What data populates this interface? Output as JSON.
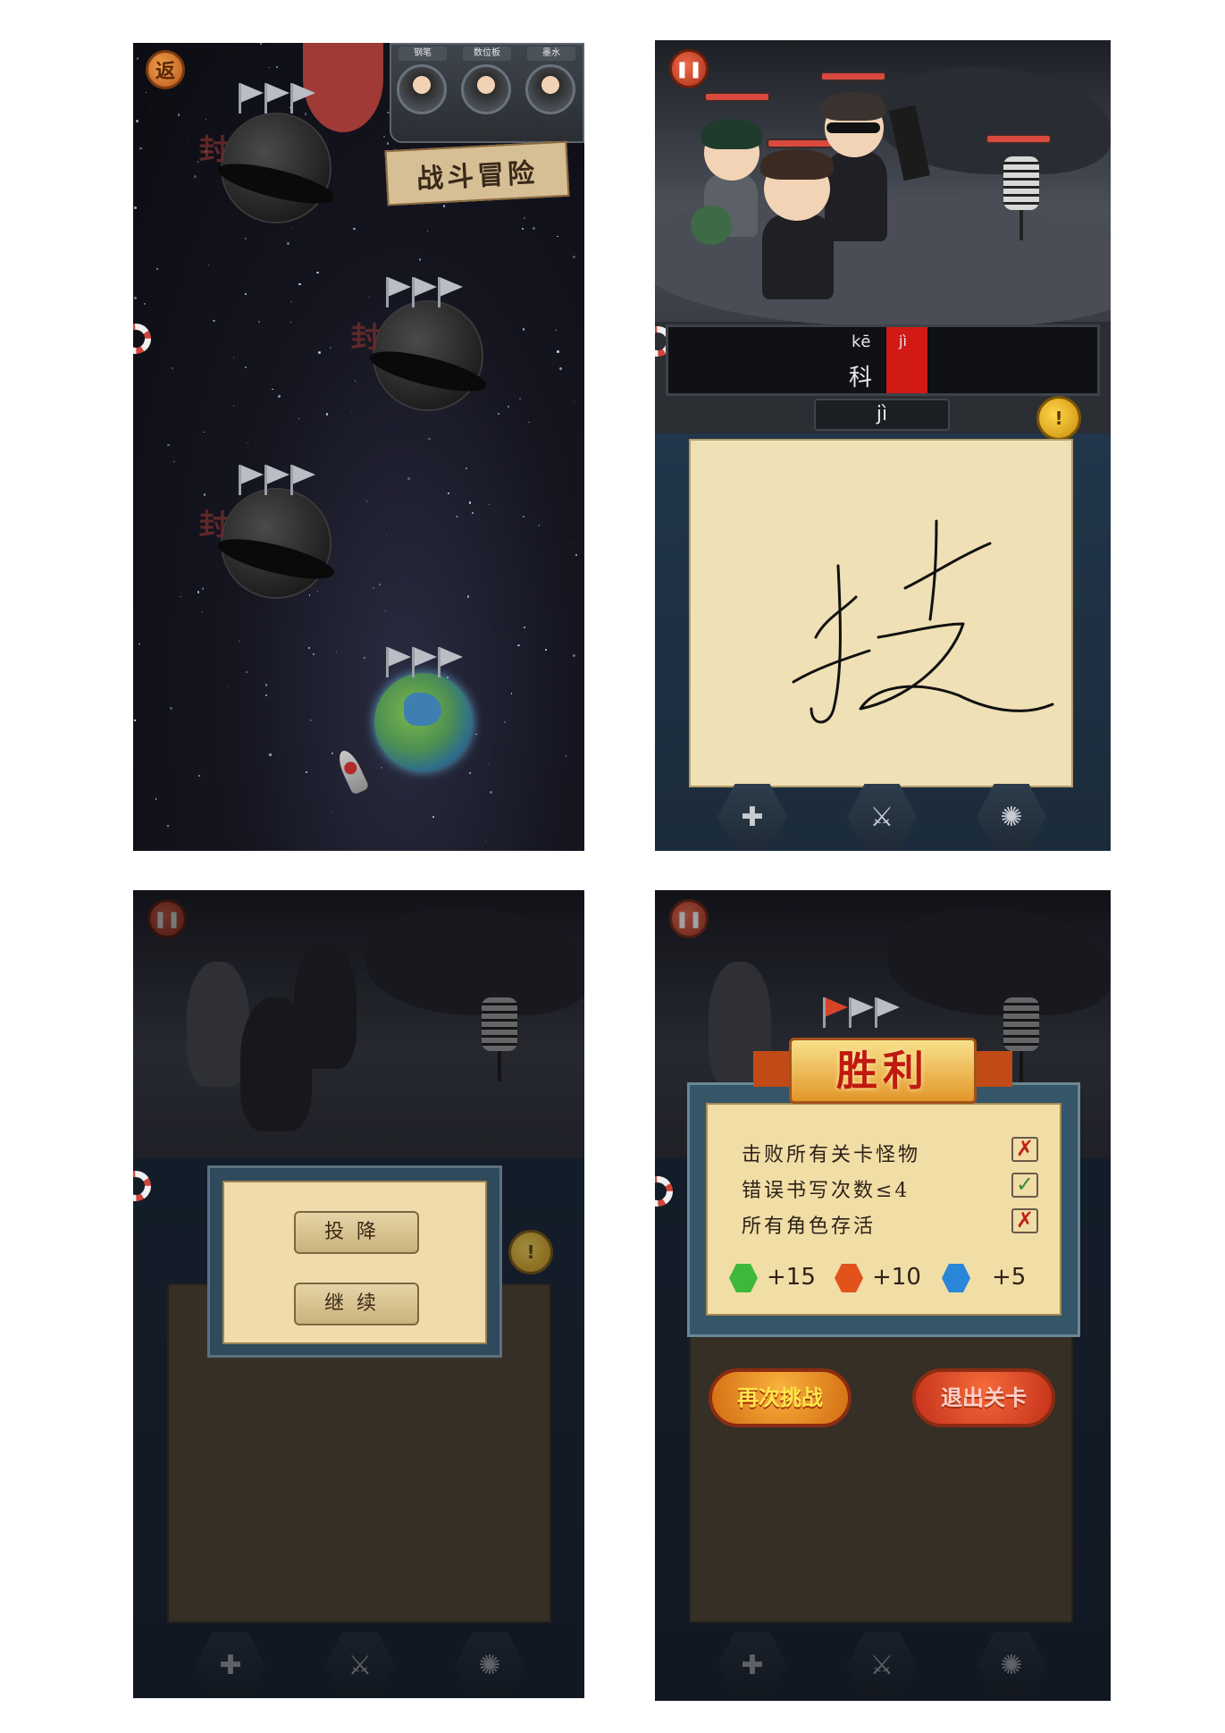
{
  "screen1": {
    "back_button": "返",
    "tools": [
      "钢笔",
      "数位板",
      "墨水"
    ],
    "title": "战斗冒险",
    "planet_seal": "封"
  },
  "screen2": {
    "pinyin": [
      "kē",
      "jì"
    ],
    "hanzi": "科",
    "answer": "jì",
    "handwriting": "技",
    "hint_icon": "!"
  },
  "screen3": {
    "buttons": [
      "投降",
      "继续"
    ]
  },
  "screen4": {
    "banner": "胜利",
    "objectives": [
      {
        "text": "击败所有关卡怪物",
        "status": "fail"
      },
      {
        "text": "错误书写次数≤4",
        "status": "pass"
      },
      {
        "text": "所有角色存活",
        "status": "fail"
      }
    ],
    "rewards": [
      {
        "value": "+15",
        "color": "#3fb83a"
      },
      {
        "value": "+10",
        "color": "#e2531c"
      },
      {
        "value": "+5",
        "color": "#2a86d8"
      }
    ],
    "buttons": [
      "再次挑战",
      "退出关卡"
    ]
  },
  "icons": {
    "pause": "pause-icon",
    "skills": [
      "cross-shield-icon",
      "sword-icon",
      "burst-icon"
    ],
    "life_ring": "life-ring-icon"
  }
}
